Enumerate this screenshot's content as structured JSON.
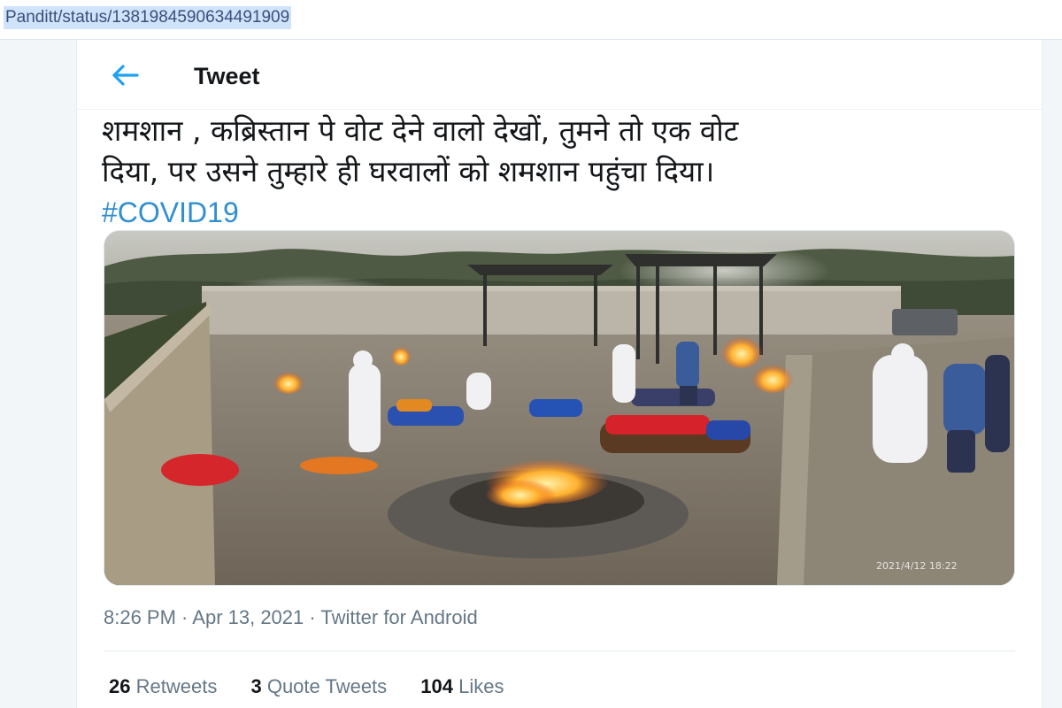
{
  "browser": {
    "url": "Panditt/status/1381984590634491909"
  },
  "header": {
    "back_icon": "arrow-left-icon",
    "title": "Tweet",
    "accent_color": "#1da1f2"
  },
  "tweet": {
    "text_line1": "शमशान , कब्रिस्तान पे वोट देने वालो देखों, तुमने तो एक वोट",
    "text_line2": "दिया, पर उसने तुम्हारे ही घरवालों को शमशान पहुंचा दिया।",
    "hashtag": "#COVID19",
    "media_timestamp": "2021/4/12 18:22",
    "time": "8:26 PM",
    "separator": " · ",
    "date": "Apr 13, 2021",
    "source": "Twitter for Android"
  },
  "stats": {
    "retweets_count": "26",
    "retweets_label": "Retweets",
    "quote_count": "3",
    "quote_label": "Quote Tweets",
    "likes_count": "104",
    "likes_label": "Likes"
  }
}
